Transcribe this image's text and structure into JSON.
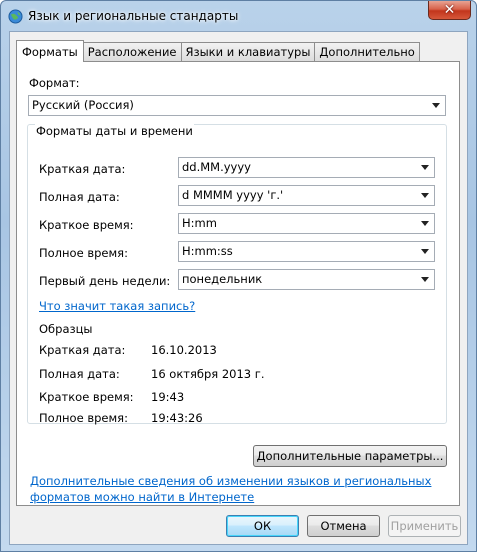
{
  "window": {
    "title": "Язык и региональные стандарты",
    "close_glyph": "✕"
  },
  "tabs": [
    {
      "label": "Форматы",
      "active": true
    },
    {
      "label": "Расположение",
      "active": false
    },
    {
      "label": "Языки и клавиатуры",
      "active": false
    },
    {
      "label": "Дополнительно",
      "active": false
    }
  ],
  "format": {
    "label": "Формат:",
    "value": "Русский (Россия)"
  },
  "datetime": {
    "group_title": "Форматы даты и времени",
    "short_date": {
      "label": "Краткая дата:",
      "value": "dd.MM.yyyy"
    },
    "long_date": {
      "label": "Полная дата:",
      "value": "d MMMM yyyy 'г.'"
    },
    "short_time": {
      "label": "Краткое время:",
      "value": "H:mm"
    },
    "long_time": {
      "label": "Полное время:",
      "value": "H:mm:ss"
    },
    "first_day": {
      "label": "Первый день недели:",
      "value": "понедельник"
    },
    "notation_link": "Что значит такая запись?"
  },
  "samples": {
    "title": "Образцы",
    "short_date": {
      "label": "Краткая дата:",
      "value": "16.10.2013"
    },
    "long_date": {
      "label": "Полная дата:",
      "value": "16 октября 2013 г."
    },
    "short_time": {
      "label": "Краткое время:",
      "value": "19:43"
    },
    "long_time": {
      "label": "Полное время:",
      "value": "19:43:26"
    }
  },
  "advanced_button": "Дополнительные параметры...",
  "info_link": {
    "line1": "Дополнительные сведения об изменении языков и региональных",
    "line2": "форматов можно найти в Интернете"
  },
  "buttons": {
    "ok": "ОК",
    "cancel": "Отмена",
    "apply": "Применить"
  },
  "colors": {
    "link": "#0066cc",
    "title_bar": "#b9d2ea",
    "close_button": "#c2351c"
  }
}
